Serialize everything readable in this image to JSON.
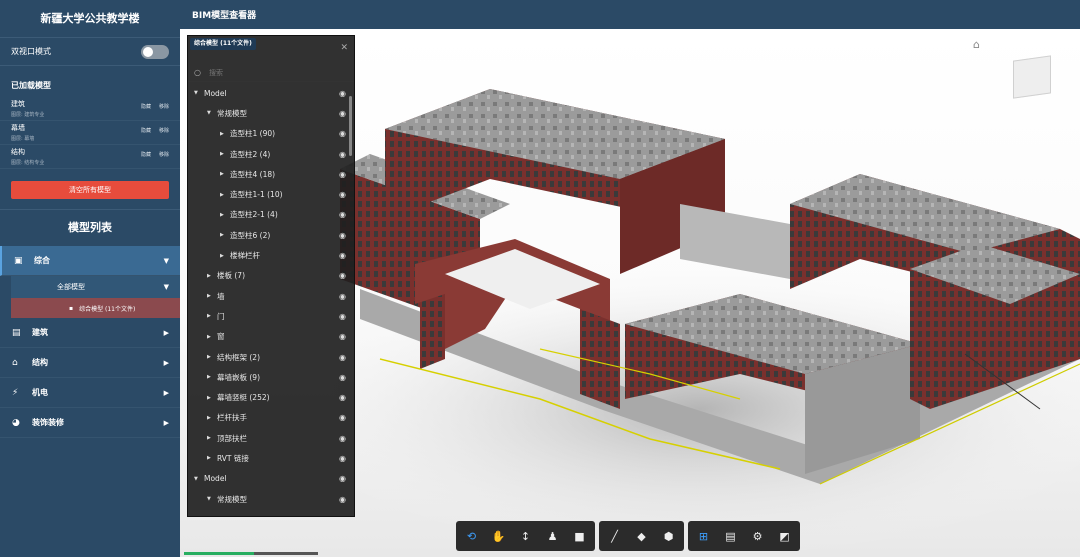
{
  "sidebar": {
    "title": "新疆大学公共教学楼",
    "dual_view_label": "双视口模式",
    "loaded_header": "已加载模型",
    "loaded": [
      {
        "name": "建筑",
        "sub": "图层: 建筑专业",
        "hide": "隐藏",
        "remove": "移除"
      },
      {
        "name": "幕墙",
        "sub": "图层: 幕墙",
        "hide": "隐藏",
        "remove": "移除"
      },
      {
        "name": "结构",
        "sub": "图层: 结构专业",
        "hide": "隐藏",
        "remove": "移除"
      }
    ],
    "clear_button": "清空所有模型",
    "list_title": "模型列表",
    "categories": [
      {
        "label": "综合",
        "icon": "building-icon"
      },
      {
        "label": "建筑",
        "icon": "brick-icon"
      },
      {
        "label": "结构",
        "icon": "structure-icon"
      },
      {
        "label": "机电",
        "icon": "bolt-icon"
      },
      {
        "label": "装饰装修",
        "icon": "palette-icon"
      }
    ],
    "sub_all": "全部模型",
    "sub_model": "综合模型 (11个文件)"
  },
  "header": {
    "title": "BIM模型查看器"
  },
  "tree": {
    "tab": "综合模型 (11个文件)",
    "search_placeholder": "搜索",
    "rows": [
      {
        "label": "Model",
        "level": 0,
        "expanded": true
      },
      {
        "label": "常规模型",
        "level": 1,
        "expanded": true
      },
      {
        "label": "造型柱1 (90)",
        "level": 2,
        "expanded": false
      },
      {
        "label": "造型柱2 (4)",
        "level": 2,
        "expanded": false
      },
      {
        "label": "造型柱4 (18)",
        "level": 2,
        "expanded": false
      },
      {
        "label": "造型柱1-1 (10)",
        "level": 2,
        "expanded": false
      },
      {
        "label": "造型柱2-1 (4)",
        "level": 2,
        "expanded": false
      },
      {
        "label": "造型柱6 (2)",
        "level": 2,
        "expanded": false
      },
      {
        "label": "楼梯栏杆",
        "level": 2,
        "expanded": false
      },
      {
        "label": "楼板 (7)",
        "level": 1,
        "expanded": false
      },
      {
        "label": "墙",
        "level": 1,
        "expanded": false
      },
      {
        "label": "门",
        "level": 1,
        "expanded": false
      },
      {
        "label": "窗",
        "level": 1,
        "expanded": false
      },
      {
        "label": "结构框架 (2)",
        "level": 1,
        "expanded": false
      },
      {
        "label": "幕墙嵌板 (9)",
        "level": 1,
        "expanded": false
      },
      {
        "label": "幕墙竖梃 (252)",
        "level": 1,
        "expanded": false
      },
      {
        "label": "栏杆扶手",
        "level": 1,
        "expanded": false
      },
      {
        "label": "顶部扶栏",
        "level": 1,
        "expanded": false
      },
      {
        "label": "RVT 链接",
        "level": 1,
        "expanded": false
      },
      {
        "label": "Model",
        "level": 0,
        "expanded": true
      },
      {
        "label": "常规模型",
        "level": 1,
        "expanded": true
      }
    ]
  },
  "progress_fraction": 0.52,
  "toolbar": {
    "groups": [
      [
        "orbit-icon",
        "pan-icon",
        "zoom-icon",
        "walk-icon",
        "camera-icon"
      ],
      [
        "measure-icon",
        "section-icon",
        "explode-icon"
      ],
      [
        "model-browser-icon",
        "properties-icon",
        "settings-icon",
        "fullscreen-icon"
      ]
    ],
    "glyphs": {
      "orbit-icon": "⟲",
      "pan-icon": "✋",
      "zoom-icon": "↕",
      "walk-icon": "♟",
      "camera-icon": "■",
      "measure-icon": "╱",
      "section-icon": "◆",
      "explode-icon": "⬢",
      "model-browser-icon": "⊞",
      "properties-icon": "▤",
      "settings-icon": "⚙",
      "fullscreen-icon": "◩"
    }
  },
  "colors": {
    "sidebar_bg": "#2b4a66",
    "accent_red": "#e74c3c",
    "brick": "#8a3a35",
    "active_tool": "#3ea0ff"
  }
}
